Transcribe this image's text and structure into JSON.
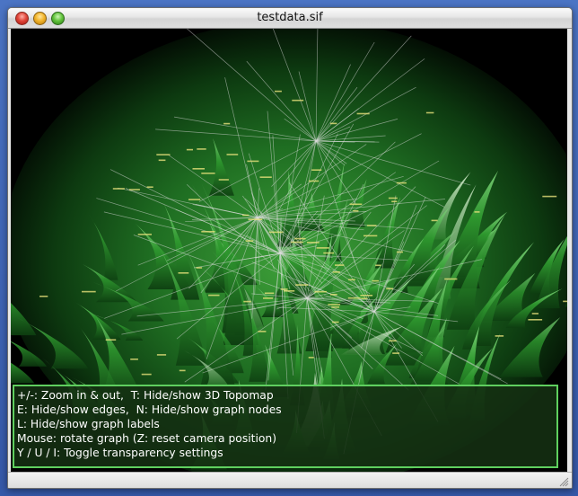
{
  "window": {
    "title": "testdata.sif"
  },
  "help_panel": {
    "lines": [
      "+/-: Zoom in & out,  T: Hide/show 3D Topomap",
      "E: Hide/show edges,  N: Hide/show graph nodes",
      "L: Hide/show graph labels",
      "Mouse: rotate graph (Z: reset camera position)",
      "Y / U / I: Toggle transparency settings"
    ]
  },
  "colors": {
    "topomap_green": "#2f9a2f",
    "topomap_dark": "#0f3a12",
    "edge_color": "#d8d8d8",
    "help_border": "#5fcf5f"
  },
  "icons": {
    "close": "close-icon",
    "minimize": "minimize-icon",
    "zoom": "zoom-icon",
    "resize": "resize-grip-icon"
  }
}
